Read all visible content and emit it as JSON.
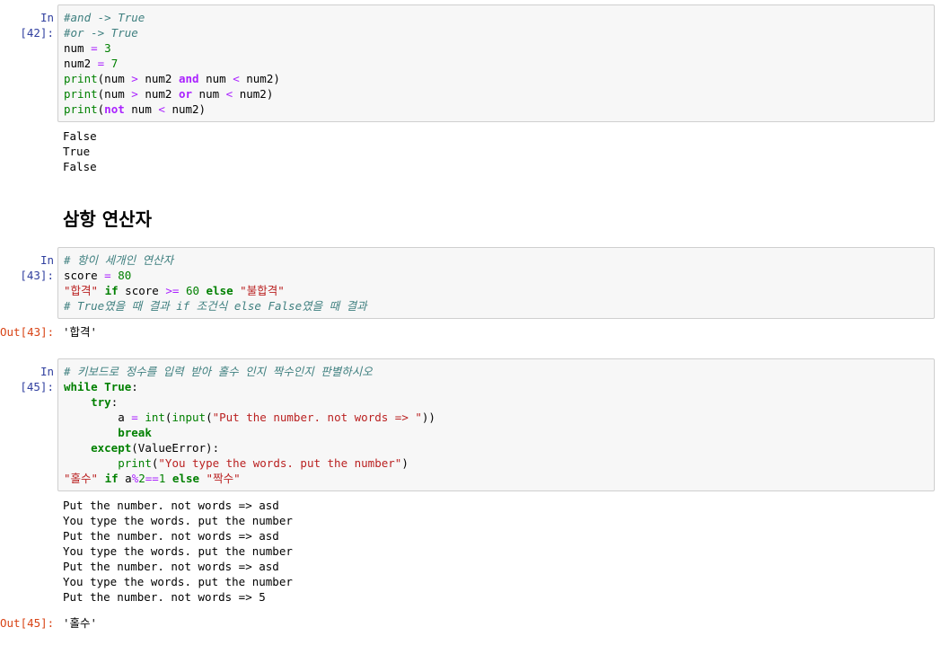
{
  "cells": [
    {
      "in_prompt": "In [42]:",
      "code": [
        [
          {
            "t": "cm",
            "v": "#and -> True"
          }
        ],
        [
          {
            "t": "cm",
            "v": "#or -> True"
          }
        ],
        [
          {
            "t": "nm",
            "v": "num "
          },
          {
            "t": "op",
            "v": "="
          },
          {
            "t": "nm",
            "v": " "
          },
          {
            "t": "num",
            "v": "3"
          }
        ],
        [
          {
            "t": "nm",
            "v": "num2 "
          },
          {
            "t": "op",
            "v": "="
          },
          {
            "t": "nm",
            "v": " "
          },
          {
            "t": "num",
            "v": "7"
          }
        ],
        [
          {
            "t": "bi",
            "v": "print"
          },
          {
            "t": "nm",
            "v": "(num "
          },
          {
            "t": "op",
            "v": ">"
          },
          {
            "t": "nm",
            "v": " num2 "
          },
          {
            "t": "opw",
            "v": "and"
          },
          {
            "t": "nm",
            "v": " num "
          },
          {
            "t": "op",
            "v": "<"
          },
          {
            "t": "nm",
            "v": " num2)"
          }
        ],
        [
          {
            "t": "bi",
            "v": "print"
          },
          {
            "t": "nm",
            "v": "(num "
          },
          {
            "t": "op",
            "v": ">"
          },
          {
            "t": "nm",
            "v": " num2 "
          },
          {
            "t": "opw",
            "v": "or"
          },
          {
            "t": "nm",
            "v": " num "
          },
          {
            "t": "op",
            "v": "<"
          },
          {
            "t": "nm",
            "v": " num2)"
          }
        ],
        [
          {
            "t": "bi",
            "v": "print"
          },
          {
            "t": "nm",
            "v": "("
          },
          {
            "t": "opw",
            "v": "not"
          },
          {
            "t": "nm",
            "v": " num "
          },
          {
            "t": "op",
            "v": "<"
          },
          {
            "t": "nm",
            "v": " num2)"
          }
        ]
      ],
      "stdout": [
        "False",
        "True",
        "False"
      ]
    },
    {
      "markdown_heading": "삼항 연산자"
    },
    {
      "in_prompt": "In [43]:",
      "code": [
        [
          {
            "t": "cm",
            "v": "# 항이 세개인 연산자"
          }
        ],
        [
          {
            "t": "nm",
            "v": "score "
          },
          {
            "t": "op",
            "v": "="
          },
          {
            "t": "nm",
            "v": " "
          },
          {
            "t": "num",
            "v": "80"
          }
        ],
        [
          {
            "t": "str",
            "v": "\"합격\""
          },
          {
            "t": "nm",
            "v": " "
          },
          {
            "t": "kw",
            "v": "if"
          },
          {
            "t": "nm",
            "v": " score "
          },
          {
            "t": "op",
            "v": ">="
          },
          {
            "t": "nm",
            "v": " "
          },
          {
            "t": "num",
            "v": "60"
          },
          {
            "t": "nm",
            "v": " "
          },
          {
            "t": "kw",
            "v": "else"
          },
          {
            "t": "nm",
            "v": " "
          },
          {
            "t": "str",
            "v": "\"불합격\""
          }
        ],
        [
          {
            "t": "cm",
            "v": "# True였을 때 결과 if 조건식 else False였을 때 결과"
          }
        ]
      ],
      "out_prompt": "Out[43]:",
      "result": "'합격'"
    },
    {
      "in_prompt": "In [45]:",
      "code": [
        [
          {
            "t": "cm",
            "v": "# 키보드로 정수를 입력 받아 홀수 인지 짝수인지 판별하시오"
          }
        ],
        [
          {
            "t": "kw",
            "v": "while"
          },
          {
            "t": "nm",
            "v": " "
          },
          {
            "t": "kw",
            "v": "True"
          },
          {
            "t": "nm",
            "v": ":"
          }
        ],
        [
          {
            "t": "nm",
            "v": "    "
          },
          {
            "t": "kw",
            "v": "try"
          },
          {
            "t": "nm",
            "v": ":"
          }
        ],
        [
          {
            "t": "nm",
            "v": "        a "
          },
          {
            "t": "op",
            "v": "="
          },
          {
            "t": "nm",
            "v": " "
          },
          {
            "t": "bi",
            "v": "int"
          },
          {
            "t": "nm",
            "v": "("
          },
          {
            "t": "bi",
            "v": "input"
          },
          {
            "t": "nm",
            "v": "("
          },
          {
            "t": "str",
            "v": "\"Put the number. not words => \""
          },
          {
            "t": "nm",
            "v": "))"
          }
        ],
        [
          {
            "t": "nm",
            "v": "        "
          },
          {
            "t": "kw",
            "v": "break"
          }
        ],
        [
          {
            "t": "nm",
            "v": "    "
          },
          {
            "t": "kw",
            "v": "except"
          },
          {
            "t": "nm",
            "v": "(ValueError):"
          }
        ],
        [
          {
            "t": "nm",
            "v": "        "
          },
          {
            "t": "bi",
            "v": "print"
          },
          {
            "t": "nm",
            "v": "("
          },
          {
            "t": "str",
            "v": "\"You type the words. put the number\""
          },
          {
            "t": "nm",
            "v": ")"
          }
        ],
        [
          {
            "t": "str",
            "v": "\"홀수\""
          },
          {
            "t": "nm",
            "v": " "
          },
          {
            "t": "kw",
            "v": "if"
          },
          {
            "t": "nm",
            "v": " a"
          },
          {
            "t": "op",
            "v": "%"
          },
          {
            "t": "num",
            "v": "2"
          },
          {
            "t": "op",
            "v": "=="
          },
          {
            "t": "num",
            "v": "1"
          },
          {
            "t": "nm",
            "v": " "
          },
          {
            "t": "kw",
            "v": "else"
          },
          {
            "t": "nm",
            "v": " "
          },
          {
            "t": "str",
            "v": "\"짝수\""
          }
        ]
      ],
      "stdout": [
        "Put the number. not words => asd",
        "You type the words. put the number",
        "Put the number. not words => asd",
        "You type the words. put the number",
        "Put the number. not words => asd",
        "You type the words. put the number",
        "Put the number. not words => 5"
      ],
      "out_prompt": "Out[45]:",
      "result": "'홀수'"
    }
  ]
}
